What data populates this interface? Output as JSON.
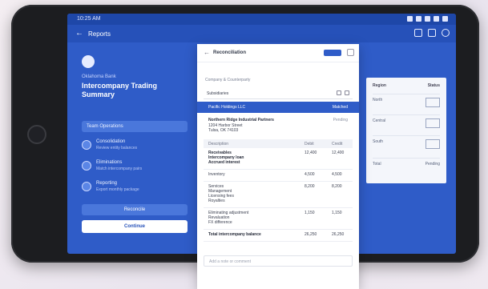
{
  "status_bar": {
    "time": "10:25 AM"
  },
  "app_bar": {
    "title": "Reports"
  },
  "left_panel": {
    "eyebrow": "Oklahoma Bank",
    "headline": "Intercompany Trading Summary",
    "pill": "Team Operations",
    "features": [
      {
        "title": "Consolidation",
        "subtitle": "Review entity balances"
      },
      {
        "title": "Eliminations",
        "subtitle": "Match intercompany pairs"
      },
      {
        "title": "Reporting",
        "subtitle": "Export monthly package"
      }
    ],
    "primary_button": "Reconcile",
    "secondary_button": "Continue"
  },
  "card": {
    "title": "Reconciliation",
    "section_label": "Company & Counterparty",
    "field_label": "Subsidiaries",
    "selected_left": "Pacific Holdings LLC",
    "selected_right": "Matched",
    "address": {
      "line1": "Northern Ridge Industrial Partners",
      "line2": "1204 Harbor Street",
      "line3": "Tulsa, OK 74103",
      "right": "Pending"
    },
    "table_header": [
      "Description",
      "Debit",
      "Credit"
    ],
    "rows": [
      {
        "c0": [
          "Receivables",
          "Intercompany loan",
          "Accrued interest"
        ],
        "c1": "12,400",
        "c2": "12,400",
        "bold": true
      },
      {
        "c0": [
          "Inventory"
        ],
        "c1": "4,500",
        "c2": "4,500",
        "bold": false
      },
      {
        "c0": [
          "Services",
          "Management",
          "Licensing fees",
          "Royalties"
        ],
        "c1": "8,200",
        "c2": "8,200",
        "bold": false
      },
      {
        "c0": [
          "Eliminating adjustment",
          "Revaluation",
          "FX difference"
        ],
        "c1": "1,150",
        "c2": "1,150",
        "bold": false
      },
      {
        "c0": [
          "Total intercompany balance"
        ],
        "c1": "26,250",
        "c2": "26,250",
        "bold": true
      }
    ],
    "footer_placeholder": "Add a note or comment"
  },
  "side_panel": {
    "header": [
      "Region",
      "Status"
    ],
    "rows": [
      "North",
      "Central",
      "South"
    ],
    "footer": [
      "Total",
      "Pending"
    ]
  }
}
